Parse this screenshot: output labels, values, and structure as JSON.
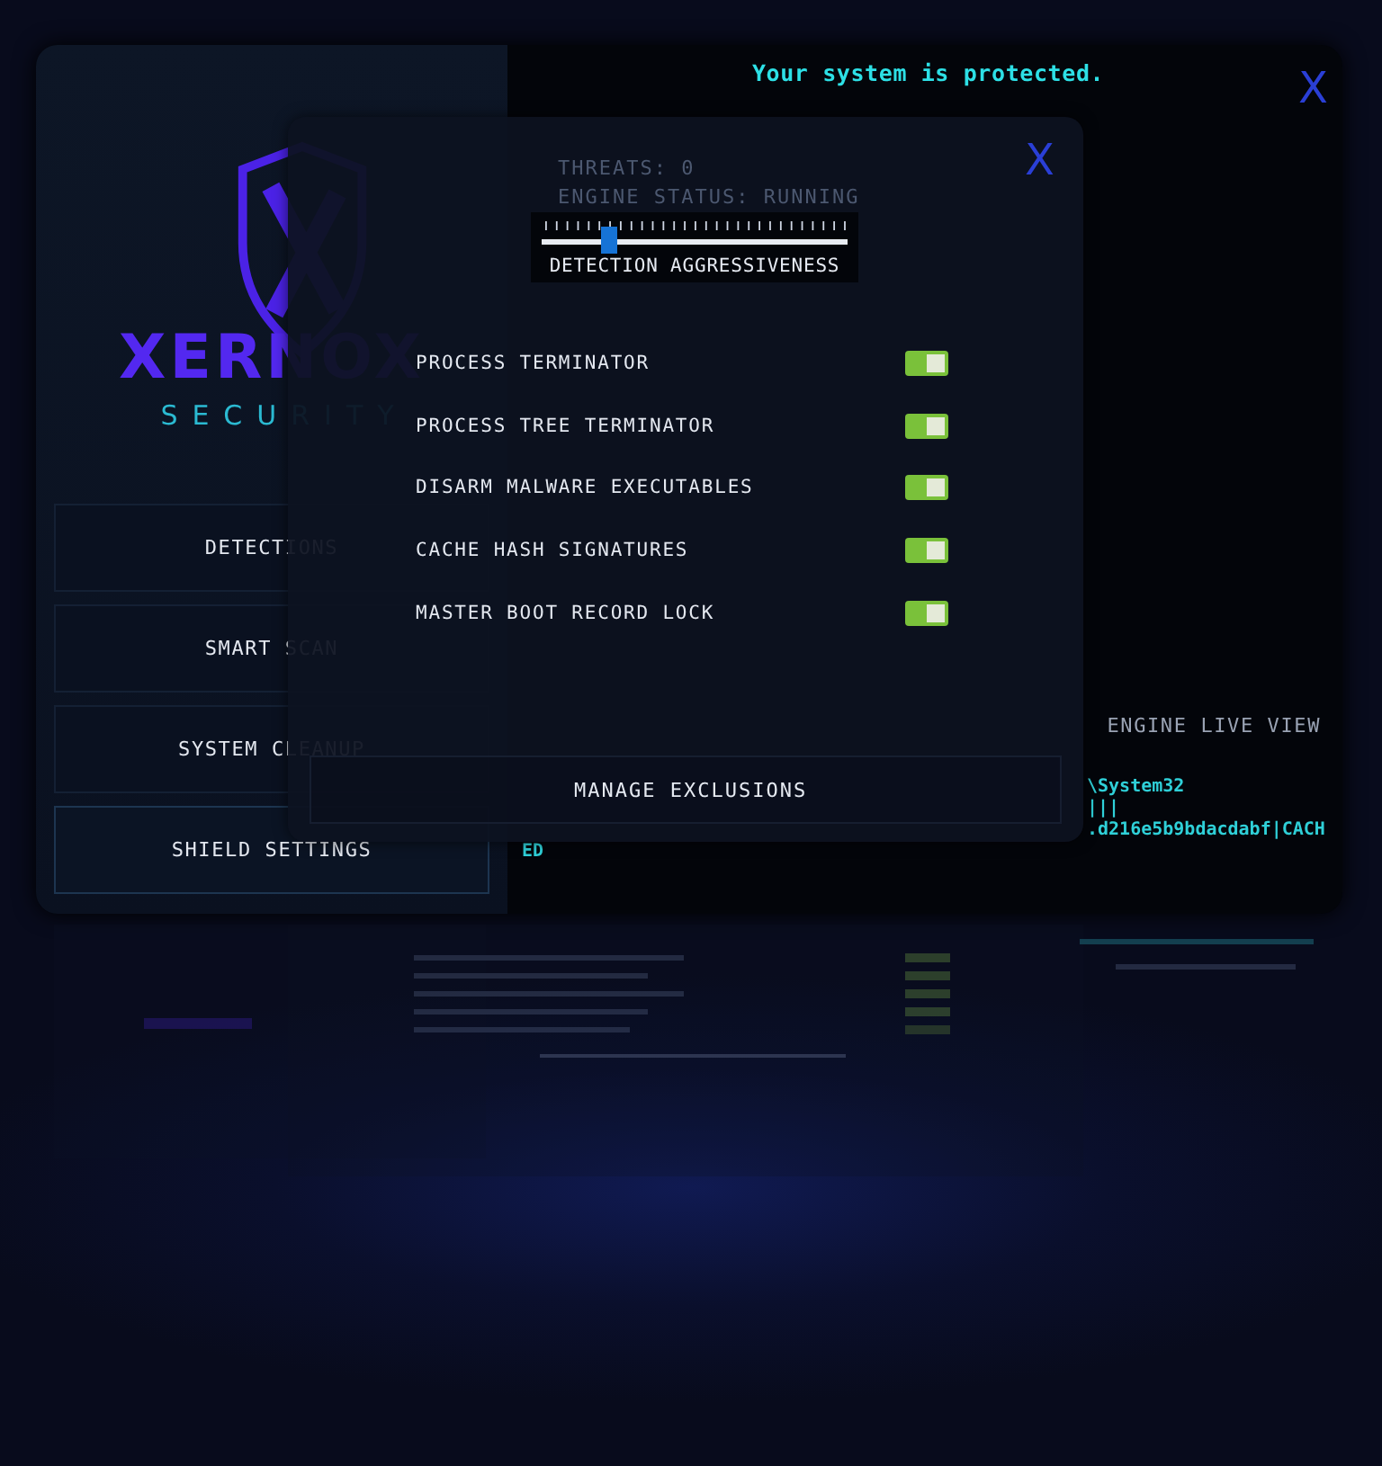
{
  "window": {
    "status_message": "Your system is protected.",
    "close": "X"
  },
  "brand": {
    "name": "XERNOX",
    "tagline": "SECURITY"
  },
  "nav": [
    {
      "label": "DETECTIONS",
      "selected": false
    },
    {
      "label": "SMART SCAN",
      "selected": false
    },
    {
      "label": "SYSTEM CLEANUP",
      "selected": false
    },
    {
      "label": "SHIELD SETTINGS",
      "selected": true
    }
  ],
  "stats": [
    "THREATS: 0",
    "ENGINE STATUS: RUNNING"
  ],
  "live_view": {
    "title": "ENGINE LIVE VIEW",
    "lines": [
      {
        "kind": "tail",
        "text": "\\System32"
      },
      {
        "kind": "tail",
        "text": "|||"
      },
      {
        "kind": "tail",
        "text": ".d216e5b9bdacdabf|CACH"
      },
      {
        "kind": "wrap",
        "text": "ED"
      }
    ]
  },
  "dialog": {
    "close": "X",
    "slider": {
      "label": "DETECTION AGGRESSIVENESS",
      "level": 0.22
    },
    "options": [
      {
        "label": "PROCESS TERMINATOR",
        "on": true
      },
      {
        "label": "PROCESS TREE TERMINATOR",
        "on": true
      },
      {
        "label": "DISARM MALWARE EXECUTABLES",
        "on": true
      },
      {
        "label": "CACHE HASH SIGNATURES",
        "on": true
      },
      {
        "label": "MASTER BOOT RECORD LOCK",
        "on": true
      }
    ],
    "button": "MANAGE EXCLUSIONS"
  }
}
